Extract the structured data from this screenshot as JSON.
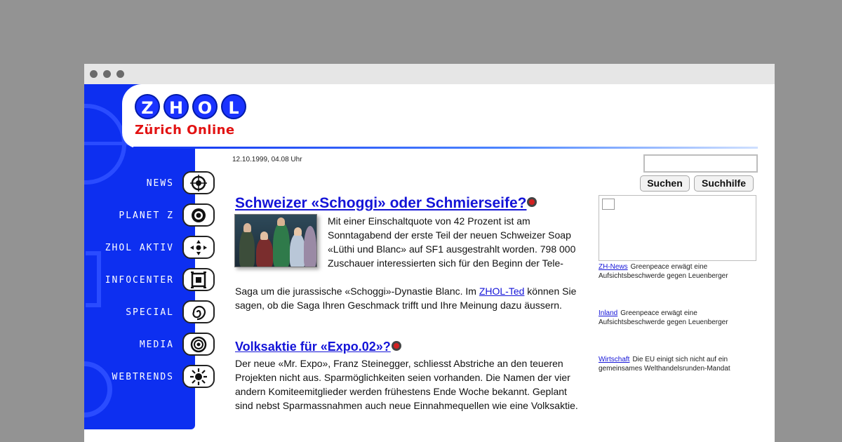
{
  "logo": {
    "letters": [
      "Z",
      "H",
      "O",
      "L"
    ],
    "subtitle": "Zürich Online"
  },
  "nav": [
    {
      "label": "NEWS",
      "icon": "compass-icon"
    },
    {
      "label": "PLANET Z",
      "icon": "planet-icon"
    },
    {
      "label": "ZHOL AKTIV",
      "icon": "arrows-icon"
    },
    {
      "label": "INFOCENTER",
      "icon": "target-square-icon"
    },
    {
      "label": "SPECIAL",
      "icon": "spiral-icon"
    },
    {
      "label": "MEDIA",
      "icon": "rings-icon"
    },
    {
      "label": "WEBTRENDS",
      "icon": "sun-icon"
    }
  ],
  "datetime": "12.10.1999, 04.08 Uhr",
  "search": {
    "value": "",
    "search_button": "Suchen",
    "help_button": "Suchhilfe"
  },
  "articles": [
    {
      "title": "Schweizer «Schoggi» oder Schmierseife?",
      "text_top": "Mit einer Einschaltquote von 42 Prozent ist am Sonntagabend der erste Teil der neuen Schweizer Soap «Lüthi und Blanc» auf SF1 ausgestrahlt worden. 798 000 Zuschauer interessierten sich für den Beginn der Tele-",
      "text_before_link": "Saga um die jurassische «Schoggi»-Dynastie Blanc. Im ",
      "link": "ZHOL-Ted",
      "text_after_link": " können Sie sagen, ob die Saga Ihren Geschmack trifft und Ihre Meinung dazu äussern."
    },
    {
      "title": "Volksaktie für «Expo.02»?",
      "text": "Der neue «Mr. Expo», Franz Steinegger, schliesst Abstriche an den teueren Projekten nicht aus. Sparmöglichkeiten seien vorhanden. Die Namen der vier andern Komiteemitglieder werden frühestens Ende Woche bekannt. Geplant sind nebst Sparmassnahmen auch neue Einnahmequellen wie eine Volksaktie."
    }
  ],
  "sidebar": [
    {
      "link": "ZH-News",
      "text": "Greenpeace erwägt eine Aufsichtsbeschwerde gegen Leuenberger"
    },
    {
      "link": "Inland",
      "text": "Greenpeace erwägt eine Aufsichtsbeschwerde gegen Leuenberger"
    },
    {
      "link": "Wirtschaft",
      "text": "Die EU einigt sich nicht auf ein gemeinsames Welthandelsrunden-Mandat"
    }
  ],
  "colors": {
    "nav_blue": "#0d2ff0",
    "logo_red": "#e21212",
    "link_blue": "#1414d8"
  }
}
